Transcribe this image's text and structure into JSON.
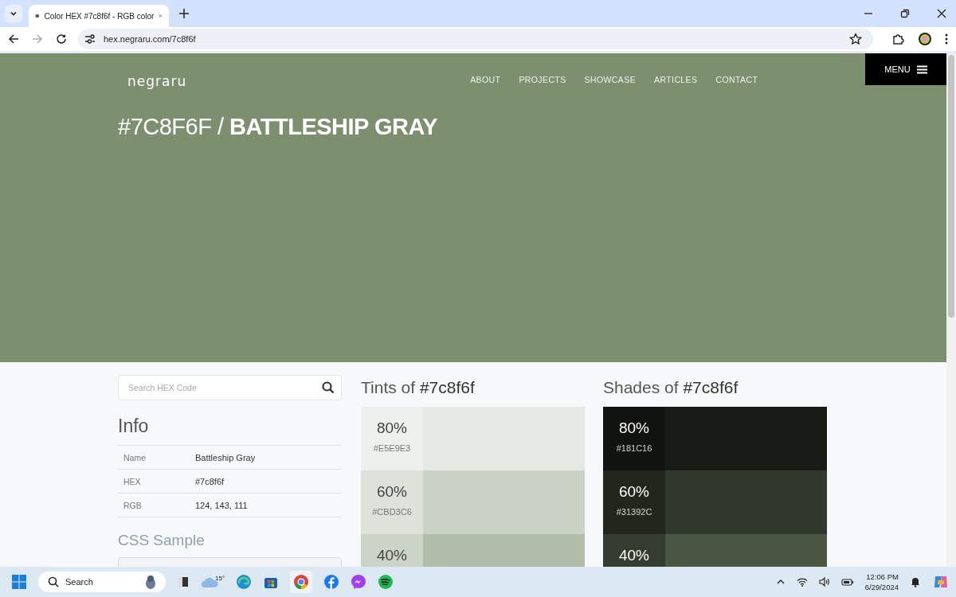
{
  "browser": {
    "tab": {
      "title": "Color HEX #7c8f6f - RGB color",
      "selected": true
    },
    "address": "hex.negraru.com/7c8f6f"
  },
  "site": {
    "logo": "negraru",
    "nav": [
      "ABOUT",
      "PROJECTS",
      "SHOWCASE",
      "ARTICLES",
      "CONTACT"
    ],
    "menu": "MENU"
  },
  "hero": {
    "color": "#7c8f6f",
    "hex": "#7C8F6F /",
    "name": "BATTLESHIP GRAY"
  },
  "search": {
    "placeholder": "Search HEX Code"
  },
  "info": {
    "title": "Info",
    "rows": [
      {
        "label": "Name",
        "value": "Battleship Gray"
      },
      {
        "label": "HEX",
        "value": "#7c8f6f"
      },
      {
        "label": "RGB",
        "value": "124, 143, 111"
      }
    ]
  },
  "css_sample": {
    "title": "CSS Sample"
  },
  "palettes": [
    {
      "kind": "tints",
      "title": "Tints of",
      "hex": "#7c8f6f",
      "swatches": [
        {
          "percent": "80%",
          "code": "#E5E9E3",
          "color": "#e5e9e3"
        },
        {
          "percent": "60%",
          "code": "#CBD3C6",
          "color": "#cbd3c6"
        },
        {
          "percent": "40%",
          "color": "#b1bca9"
        }
      ]
    },
    {
      "kind": "shades",
      "title": "Shades of",
      "hex": "#7c8f6f",
      "swatches": [
        {
          "percent": "80%",
          "code": "#181C16",
          "color": "#181c16"
        },
        {
          "percent": "60%",
          "code": "#31392C",
          "color": "#31392c"
        },
        {
          "percent": "40%",
          "color": "#4a5642"
        }
      ]
    }
  ],
  "taskbar": {
    "search": "Search",
    "weather": "15°",
    "time": "12:06 PM",
    "date": "6/29/2024"
  }
}
